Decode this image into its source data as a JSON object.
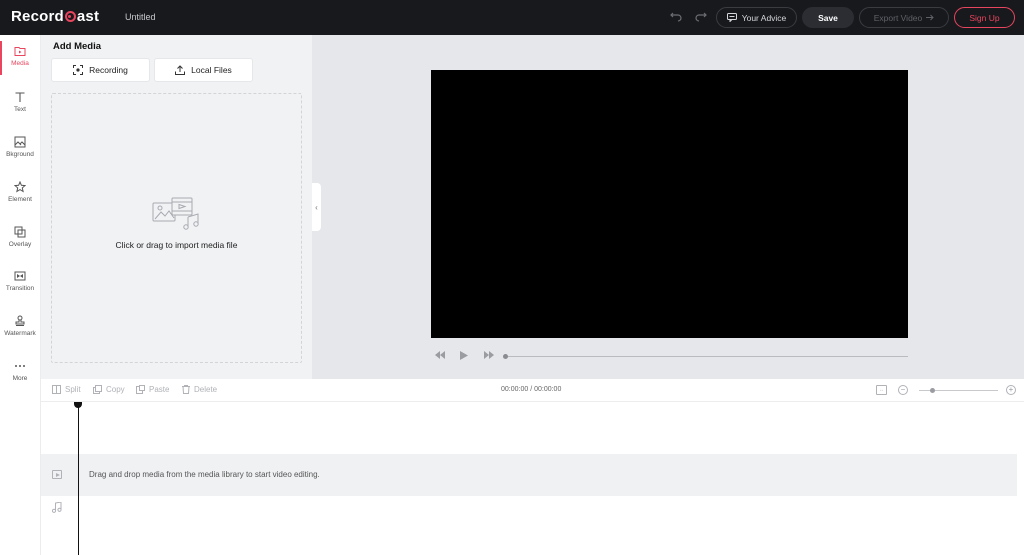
{
  "header": {
    "logo_left": "Record",
    "logo_right": "ast",
    "doc_title": "Untitled",
    "advice_label": "Your Advice",
    "save_label": "Save",
    "export_label": "Export Video",
    "signup_label": "Sign Up"
  },
  "sidebar": {
    "items": [
      {
        "label": "Media",
        "icon": "folder-icon"
      },
      {
        "label": "Text",
        "icon": "text-icon"
      },
      {
        "label": "Bkground",
        "icon": "background-icon"
      },
      {
        "label": "Element",
        "icon": "star-icon"
      },
      {
        "label": "Overlay",
        "icon": "overlay-icon"
      },
      {
        "label": "Transition",
        "icon": "transition-icon"
      },
      {
        "label": "Watermark",
        "icon": "stamp-icon"
      },
      {
        "label": "More",
        "icon": "more-icon"
      }
    ]
  },
  "media_panel": {
    "title": "Add Media",
    "recording_label": "Recording",
    "local_files_label": "Local Files",
    "drop_text": "Click or drag to import media file"
  },
  "timeline": {
    "split_label": "Split",
    "copy_label": "Copy",
    "paste_label": "Paste",
    "delete_label": "Delete",
    "timecode": "00:00:00 / 00:00:00",
    "empty_hint": "Drag and drop media from the media library to start video editing."
  },
  "colors": {
    "accent": "#e8455e",
    "topbar": "#18191d"
  }
}
